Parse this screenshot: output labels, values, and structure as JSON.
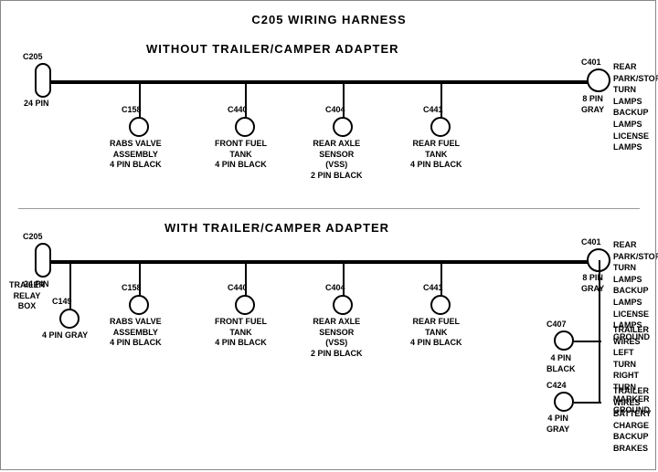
{
  "title": "C205 WIRING HARNESS",
  "section1": {
    "label": "WITHOUT  TRAILER/CAMPER  ADAPTER",
    "connectors": [
      {
        "id": "C205-top",
        "label": "C205",
        "sub": "24 PIN",
        "type": "rect"
      },
      {
        "id": "C158-top",
        "label": "C158",
        "sub": "RABS VALVE\nASSEMBLY\n4 PIN BLACK"
      },
      {
        "id": "C440-top",
        "label": "C440",
        "sub": "FRONT FUEL\nTANK\n4 PIN BLACK"
      },
      {
        "id": "C404-top",
        "label": "C404",
        "sub": "REAR AXLE\nSENSOR\n(VSS)\n2 PIN BLACK"
      },
      {
        "id": "C441-top",
        "label": "C441",
        "sub": "REAR FUEL\nTANK\n4 PIN BLACK"
      },
      {
        "id": "C401-top",
        "label": "C401",
        "sub": "8 PIN\nGRAY",
        "right_label": "REAR PARK/STOP\nTURN LAMPS\nBACKUP LAMPS\nLICENSE LAMPS"
      }
    ]
  },
  "section2": {
    "label": "WITH  TRAILER/CAMPER  ADAPTER",
    "connectors": [
      {
        "id": "C205-bot",
        "label": "C205",
        "sub": "24 PIN",
        "type": "rect"
      },
      {
        "id": "C149",
        "label": "C149",
        "sub": "4 PIN GRAY",
        "extra": "TRAILER\nRELAY\nBOX"
      },
      {
        "id": "C158-bot",
        "label": "C158",
        "sub": "RABS VALVE\nASSEMBLY\n4 PIN BLACK"
      },
      {
        "id": "C440-bot",
        "label": "C440",
        "sub": "FRONT FUEL\nTANK\n4 PIN BLACK"
      },
      {
        "id": "C404-bot",
        "label": "C404",
        "sub": "REAR AXLE\nSENSOR\n(VSS)\n2 PIN BLACK"
      },
      {
        "id": "C441-bot",
        "label": "C441",
        "sub": "REAR FUEL\nTANK\n4 PIN BLACK"
      },
      {
        "id": "C401-bot",
        "label": "C401",
        "sub": "8 PIN\nGRAY",
        "right_label": "REAR PARK/STOP\nTURN LAMPS\nBACKUP LAMPS\nLICENSE LAMPS\nGROUND"
      },
      {
        "id": "C407",
        "label": "C407",
        "sub": "4 PIN\nBLACK",
        "right_label": "TRAILER WIRES\nLEFT TURN\nRIGHT TURN\nMARKER\nGROUND"
      },
      {
        "id": "C424",
        "label": "C424",
        "sub": "4 PIN\nGRAY",
        "right_label": "TRAILER WIRES\nBATTERY CHARGE\nBACKUP\nBRAKES"
      }
    ]
  }
}
